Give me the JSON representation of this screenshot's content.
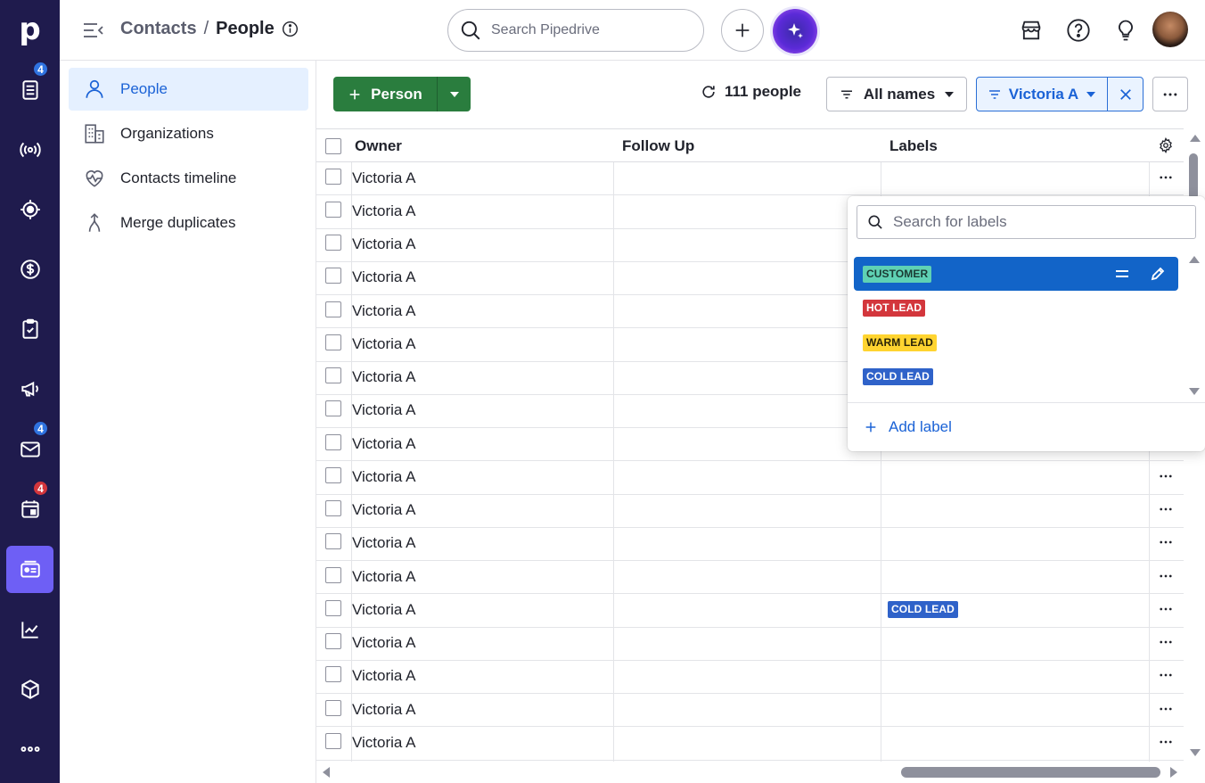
{
  "rail": {
    "logo": "p",
    "badges": {
      "leads": "4",
      "mail": "4",
      "calendar": "4"
    }
  },
  "topbar": {
    "breadcrumb_parent": "Contacts",
    "breadcrumb_separator": "/",
    "breadcrumb_current": "People",
    "search_placeholder": "Search Pipedrive"
  },
  "sidenav": {
    "items": [
      {
        "label": "People"
      },
      {
        "label": "Organizations"
      },
      {
        "label": "Contacts timeline"
      },
      {
        "label": "Merge duplicates"
      }
    ]
  },
  "toolbar": {
    "add_person_label": "Person",
    "count_label": "111 people",
    "all_names_label": "All names",
    "filter_label": "Victoria A"
  },
  "table": {
    "columns": [
      "Owner",
      "Follow Up",
      "Labels"
    ],
    "rows": [
      {
        "owner": "Victoria A",
        "label": ""
      },
      {
        "owner": "Victoria A",
        "label": ""
      },
      {
        "owner": "Victoria A",
        "label": ""
      },
      {
        "owner": "Victoria A",
        "label": ""
      },
      {
        "owner": "Victoria A",
        "label": ""
      },
      {
        "owner": "Victoria A",
        "label": ""
      },
      {
        "owner": "Victoria A",
        "label": ""
      },
      {
        "owner": "Victoria A",
        "label": ""
      },
      {
        "owner": "Victoria A",
        "label": ""
      },
      {
        "owner": "Victoria A",
        "label": ""
      },
      {
        "owner": "Victoria A",
        "label": ""
      },
      {
        "owner": "Victoria A",
        "label": ""
      },
      {
        "owner": "Victoria A",
        "label": ""
      },
      {
        "owner": "Victoria A",
        "label": "COLD LEAD"
      },
      {
        "owner": "Victoria A",
        "label": ""
      },
      {
        "owner": "Victoria A",
        "label": ""
      },
      {
        "owner": "Victoria A",
        "label": ""
      },
      {
        "owner": "Victoria A",
        "label": ""
      }
    ]
  },
  "label_dropdown": {
    "search_placeholder": "Search for labels",
    "labels": [
      {
        "name": "CUSTOMER",
        "bg": "#5fd1b4",
        "fg": "#1b3a33",
        "selected": true
      },
      {
        "name": "HOT LEAD",
        "bg": "#d3363c",
        "fg": "#ffffff",
        "selected": false
      },
      {
        "name": "WARM LEAD",
        "bg": "#ffd430",
        "fg": "#2a2408",
        "selected": false
      },
      {
        "name": "COLD LEAD",
        "bg": "#2f62c9",
        "fg": "#ffffff",
        "selected": false
      }
    ],
    "add_label": "Add label"
  },
  "colors": {
    "rail_bg": "#1f1b4d",
    "rail_active": "#6e5ff5",
    "primary_green": "#2a7d3e",
    "link_blue": "#1a62d6",
    "selected_blue": "#1264c8"
  }
}
